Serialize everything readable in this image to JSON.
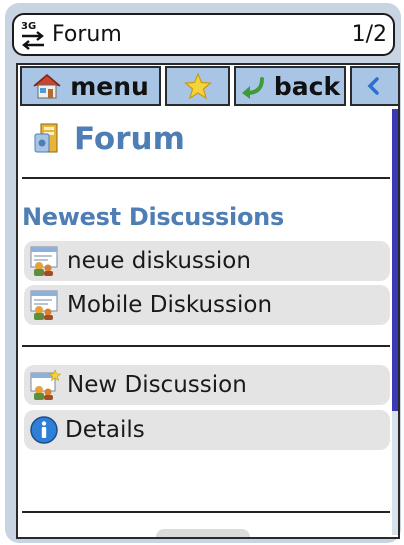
{
  "titlebar": {
    "network_label": "3G",
    "title": "Forum",
    "page_count": "1/2"
  },
  "toolbar": {
    "menu_label": "menu",
    "back_label": "back"
  },
  "page": {
    "heading": "Forum"
  },
  "newest": {
    "title": "Newest Discussions",
    "items": [
      {
        "label": "neue diskussion",
        "icon": "discussion-icon"
      },
      {
        "label": "Mobile Diskussion",
        "icon": "discussion-icon"
      }
    ]
  },
  "actions": {
    "items": [
      {
        "label": "New Discussion",
        "icon": "new-discussion-icon"
      },
      {
        "label": "Details",
        "icon": "info-icon"
      }
    ]
  },
  "colors": {
    "accent": "#4f7eb5",
    "toolbar_button": "#a9c5e6",
    "item_background": "#e4e4e4",
    "scroll_thumb": "#3a3ab8"
  }
}
